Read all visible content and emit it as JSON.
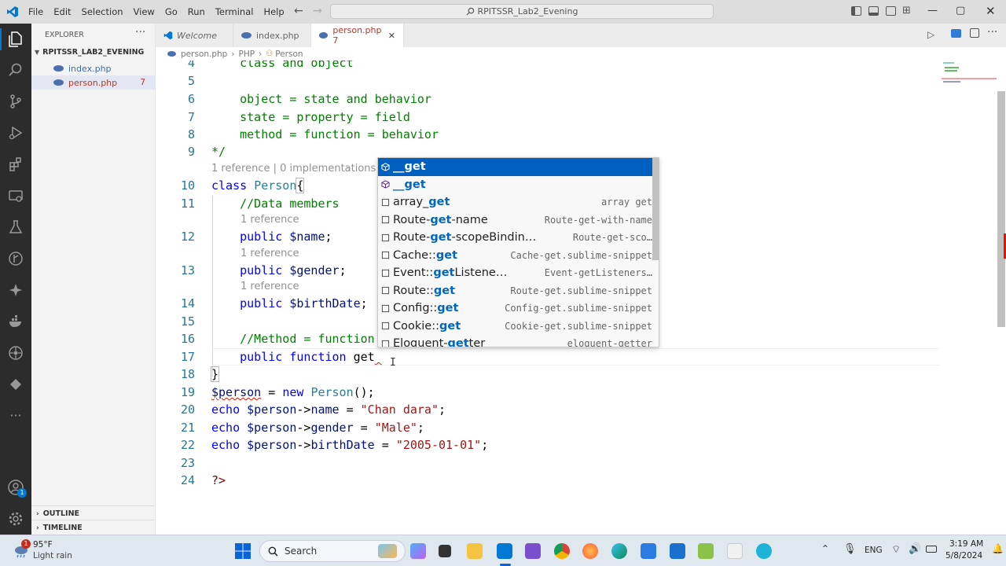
{
  "menu": [
    "File",
    "Edit",
    "Selection",
    "View",
    "Go",
    "Run",
    "Terminal",
    "Help"
  ],
  "search_box": "RPITSSR_Lab2_Evening",
  "explorer": {
    "header": "EXPLORER",
    "project": "RPITSSR_LAB2_EVENING",
    "files": [
      {
        "name": "index.php",
        "badge": ""
      },
      {
        "name": "person.php",
        "badge": "7"
      }
    ],
    "outline": "OUTLINE",
    "timeline": "TIMELINE"
  },
  "tabs": [
    {
      "label": "Welcome"
    },
    {
      "label": "index.php"
    },
    {
      "label": "person.php 7"
    }
  ],
  "breadcrumb": {
    "file": "person.php",
    "lang": "PHP",
    "symbol": "Person"
  },
  "lines": [
    {
      "n": "4",
      "code": "    class and object"
    },
    {
      "n": "5",
      "code": ""
    },
    {
      "n": "6",
      "code": "    object = state and behavior"
    },
    {
      "n": "7",
      "code": "    state = property = field"
    },
    {
      "n": "8",
      "code": "    method = function = behavior"
    },
    {
      "n": "9",
      "code": "*/"
    },
    {
      "n": "10",
      "code": "class Person{"
    },
    {
      "n": "11",
      "code": "    //Data members"
    },
    {
      "n": "12",
      "code": "    public $name;"
    },
    {
      "n": "13",
      "code": "    public $gender;"
    },
    {
      "n": "14",
      "code": "    public $birthDate;"
    },
    {
      "n": "15",
      "code": ""
    },
    {
      "n": "16",
      "code": "    //Method = function"
    },
    {
      "n": "17",
      "code": "    public function get"
    },
    {
      "n": "18",
      "code": "}"
    },
    {
      "n": "19",
      "code": "$person = new Person();"
    },
    {
      "n": "20",
      "code": "echo $person->name = \"Chan dara\";"
    },
    {
      "n": "21",
      "code": "echo $person->gender = \"Male\";"
    },
    {
      "n": "22",
      "code": "echo $person->birthDate = \"2005-01-01\";"
    },
    {
      "n": "23",
      "code": ""
    },
    {
      "n": "24",
      "code": "?>"
    }
  ],
  "codelens": {
    "class": "1 reference | 0 implementations",
    "ref": "1 reference"
  },
  "suggestions": [
    {
      "pre": "",
      "match": "__get",
      "post": "",
      "detail": ""
    },
    {
      "pre": "",
      "match": "__get",
      "post": "",
      "detail": ""
    },
    {
      "pre": "array_",
      "match": "get",
      "post": "",
      "detail": "array get"
    },
    {
      "pre": "Route-",
      "match": "get",
      "post": "-name",
      "detail": "Route-get-with-name"
    },
    {
      "pre": "Route-",
      "match": "get",
      "post": "-scopeBindin…",
      "detail": "Route-get-sco…"
    },
    {
      "pre": "Cache::",
      "match": "get",
      "post": "",
      "detail": "Cache-get.sublime-snippet"
    },
    {
      "pre": "Event::",
      "match": "get",
      "post": "Listene…",
      "detail": "Event-getListeners…"
    },
    {
      "pre": "Route::",
      "match": "get",
      "post": "",
      "detail": "Route-get.sublime-snippet"
    },
    {
      "pre": "Config::",
      "match": "get",
      "post": "",
      "detail": "Config-get.sublime-snippet"
    },
    {
      "pre": "Cookie::",
      "match": "get",
      "post": "",
      "detail": "Cookie-get.sublime-snippet"
    },
    {
      "pre": "Eloquent-",
      "match": "get",
      "post": "ter",
      "detail": "eloquent-getter"
    }
  ],
  "weather": {
    "temp": "95°F",
    "desc": "Light rain",
    "alert": "1"
  },
  "taskbar": {
    "search": "Search",
    "lang": "ENG",
    "time": "3:19 AM",
    "date": "5/8/2024"
  },
  "account_badge": "1",
  "colors": {
    "accent": "#0060c0",
    "activity_bar": "#2c2c2c",
    "taskbar": "#dfe7ef"
  }
}
